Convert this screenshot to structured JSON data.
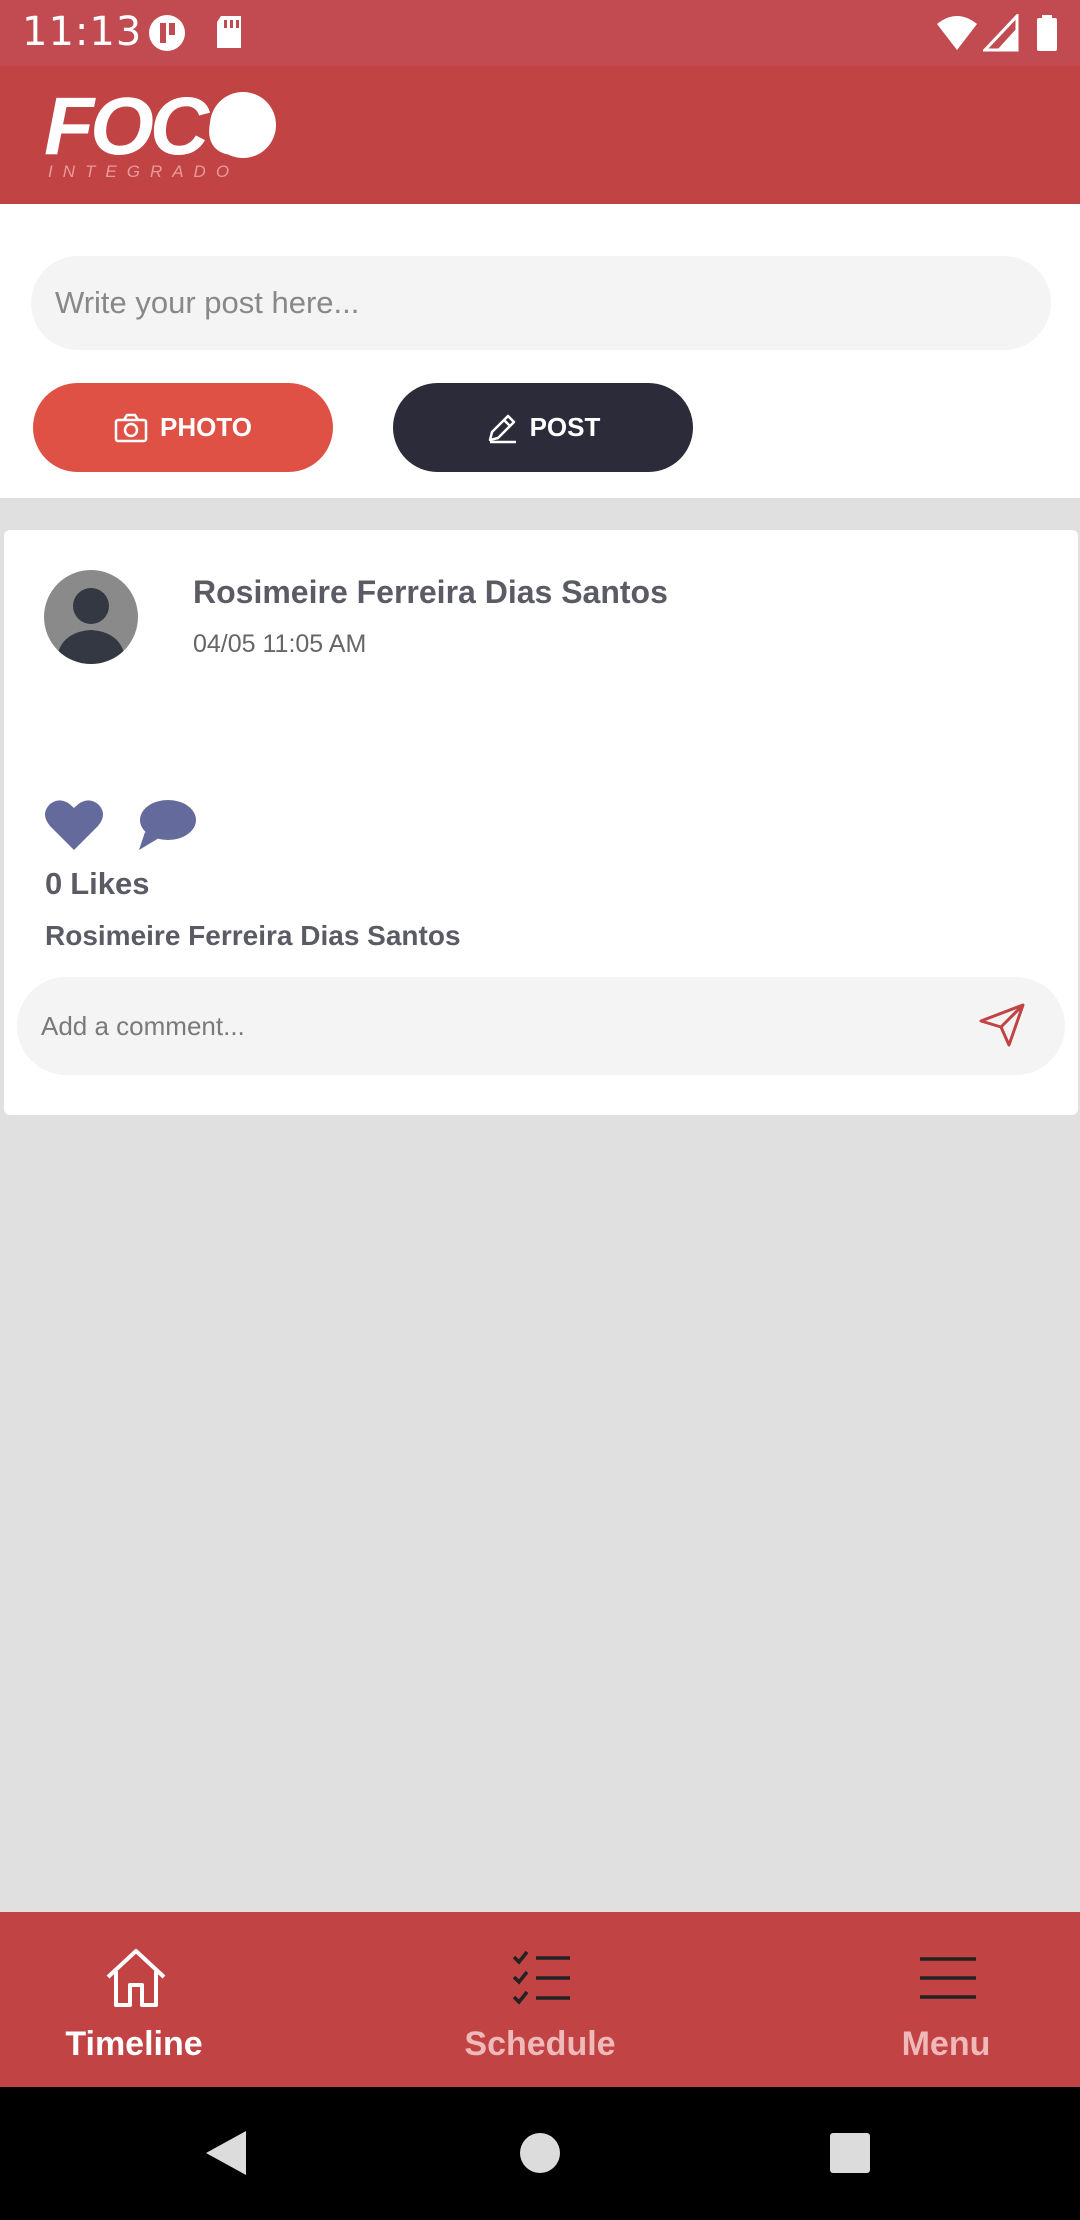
{
  "status_bar": {
    "time": "11:13",
    "left_icons": [
      "notification-app-icon",
      "sd-card-icon"
    ],
    "right_icons": [
      "wifi-icon",
      "cell-signal-icon",
      "battery-icon"
    ]
  },
  "header": {
    "logo_text": "FOCO",
    "logo_subtext": "INTEGRADO"
  },
  "composer": {
    "post_placeholder": "Write your post here...",
    "photo_button": "PHOTO",
    "post_button": "POST"
  },
  "post": {
    "author": "Rosimeire Ferreira Dias Santos",
    "timestamp": "04/05 11:05 AM",
    "likes_count": "0",
    "likes_label": "Likes",
    "caption_author": "Rosimeire Ferreira Dias Santos",
    "comment_placeholder": "Add a comment..."
  },
  "bottom_nav": {
    "items": [
      {
        "label": "Timeline",
        "icon": "home-icon",
        "active": true
      },
      {
        "label": "Schedule",
        "icon": "checklist-icon",
        "active": false
      },
      {
        "label": "Menu",
        "icon": "hamburger-menu-icon",
        "active": false
      }
    ]
  },
  "colors": {
    "brand_red": "#c14344",
    "photo_button": "#df5045",
    "post_button": "#2b2b3a",
    "icon_purple": "#646b9c"
  }
}
